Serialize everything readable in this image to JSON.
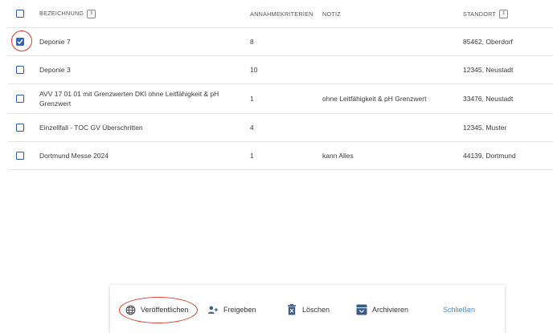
{
  "table": {
    "columns": {
      "bezeichnung": "BEZEICHNUNG",
      "annahmekriterien": "ANNAHMEKRITERIEN",
      "notiz": "NOTIZ",
      "standort": "STANDORT"
    },
    "sort_symbol": "⇕",
    "rows": [
      {
        "name": "Deponie 7",
        "kriterien": "8",
        "notiz": "",
        "standort": "85462, Oberdorf",
        "checked": true
      },
      {
        "name": "Deponie 3",
        "kriterien": "10",
        "notiz": "",
        "standort": "12345, Neustadt",
        "checked": false
      },
      {
        "name": "AVV 17 01 01 mit Grenzwerten DKI ohne Leitfähigkeit & pH Grenzwert",
        "kriterien": "1",
        "notiz": "ohne Leitfähigkeit & pH Grenzwert",
        "standort": "33476, Neustadt",
        "checked": false
      },
      {
        "name": "Einzellfall - TOC GV Überschritten",
        "kriterien": "4",
        "notiz": "",
        "standort": "12345, Muster",
        "checked": false
      },
      {
        "name": "Dortmund Messe 2024",
        "kriterien": "1",
        "notiz": "kann Alles",
        "standort": "44139, Dortmund",
        "checked": false
      }
    ]
  },
  "actions": {
    "publish": "Veröffentlichen",
    "share": "Freigeben",
    "delete": "Löschen",
    "archive": "Archivieren",
    "close": "Schließen"
  },
  "colors": {
    "accent": "#3467b8",
    "link": "#4f86c6",
    "annotation": "#e03b2b"
  }
}
